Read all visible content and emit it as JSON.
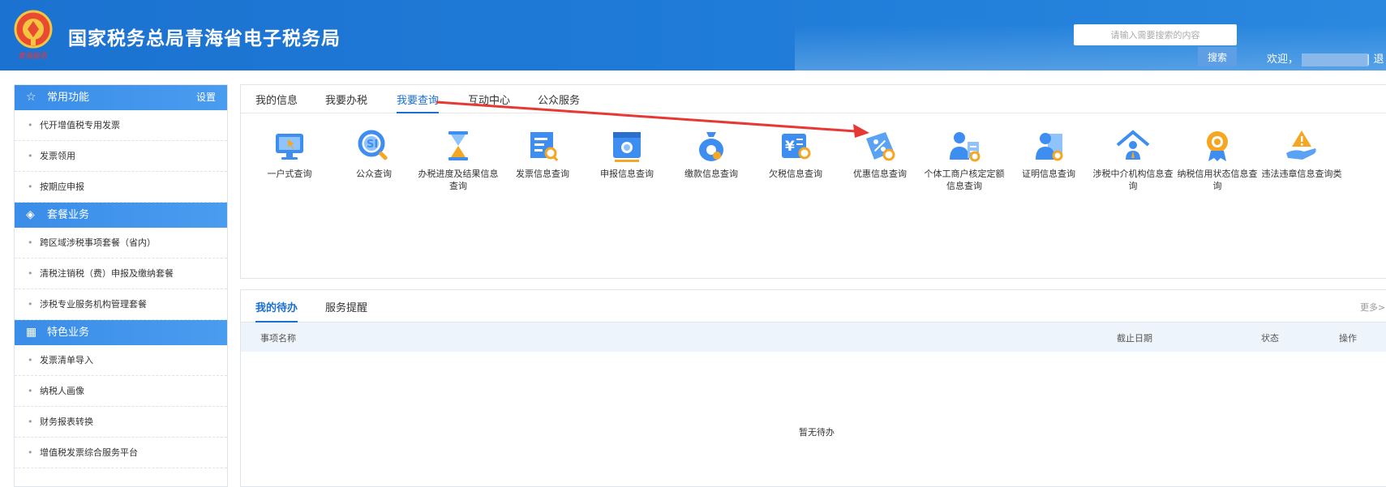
{
  "header": {
    "site_title": "国家税务总局青海省电子税务局",
    "emblem_subtext": "青海税务",
    "search_placeholder": "请输入需要搜索的内容",
    "search_button": "搜索",
    "welcome": "欢迎，",
    "logout": "| 退"
  },
  "sidebar": {
    "sections": [
      {
        "title": "常用功能",
        "icon": "star-icon",
        "settings": "设置",
        "items": [
          "代开增值税专用发票",
          "发票领用",
          "按期应申报"
        ]
      },
      {
        "title": "套餐业务",
        "icon": "layers-icon",
        "items": [
          "跨区域涉税事项套餐（省内）",
          "清税注销税（费）申报及缴纳套餐",
          "涉税专业服务机构管理套餐"
        ]
      },
      {
        "title": "特色业务",
        "icon": "grid-icon",
        "items": [
          "发票清单导入",
          "纳税人画像",
          "财务报表转换",
          "增值税发票综合服务平台"
        ]
      }
    ]
  },
  "main": {
    "tabs": [
      {
        "label": "我的信息",
        "active": false
      },
      {
        "label": "我要办税",
        "active": false
      },
      {
        "label": "我要查询",
        "active": true
      },
      {
        "label": "互动中心",
        "active": false
      },
      {
        "label": "公众服务",
        "active": false
      }
    ],
    "query_items": [
      {
        "label": "一户式查询",
        "icon": "monitor-cursor-icon"
      },
      {
        "label": "公众查询",
        "icon": "magnifier-icon"
      },
      {
        "label": "办税进度及结果信息查询",
        "icon": "hourglass-icon"
      },
      {
        "label": "发票信息查询",
        "icon": "invoice-search-icon"
      },
      {
        "label": "申报信息查询",
        "icon": "declaration-search-icon"
      },
      {
        "label": "缴款信息查询",
        "icon": "money-bag-icon"
      },
      {
        "label": "欠税信息查询",
        "icon": "tax-arrears-icon"
      },
      {
        "label": "优惠信息查询",
        "icon": "discount-tag-icon"
      },
      {
        "label": "个体工商户核定定额信息查询",
        "icon": "person-document-icon"
      },
      {
        "label": "证明信息查询",
        "icon": "certificate-icon"
      },
      {
        "label": "涉税中介机构信息查询",
        "icon": "agency-house-icon"
      },
      {
        "label": "纳税信用状态信息查询",
        "icon": "credit-medal-icon"
      },
      {
        "label": "违法违章信息查询类",
        "icon": "warning-hand-icon"
      }
    ]
  },
  "todo": {
    "tabs": [
      {
        "label": "我的待办",
        "active": true
      },
      {
        "label": "服务提醒",
        "active": false
      }
    ],
    "more": "更多>",
    "columns": {
      "name": "事项名称",
      "deadline": "截止日期",
      "status": "状态",
      "action": "操作"
    },
    "empty": "暂无待办"
  },
  "colors": {
    "header_blue": "#1f7cd8",
    "accent": "#1c6fd1",
    "annotation_red": "#e53935"
  }
}
